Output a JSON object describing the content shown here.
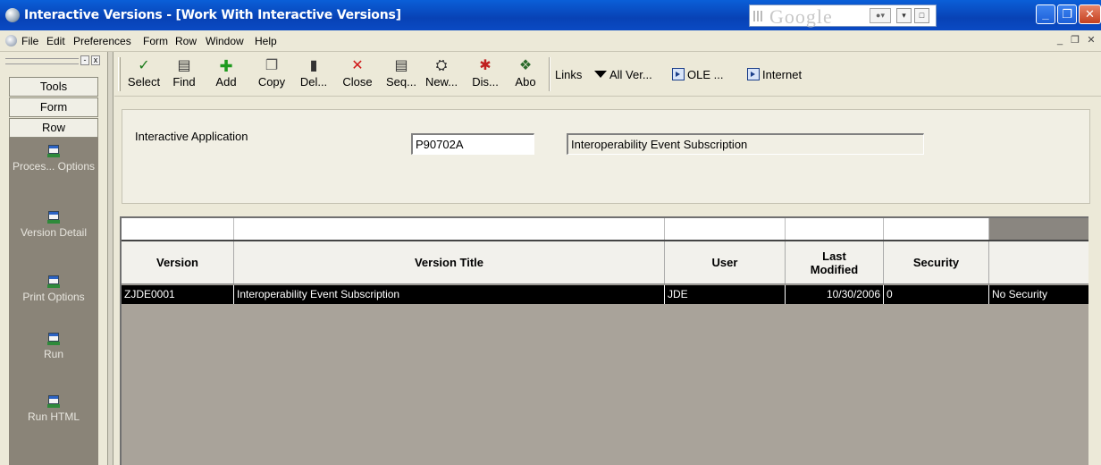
{
  "window": {
    "title": "Interactive Versions - [Work With Interactive Versions]",
    "google_logo": "Google"
  },
  "menu": [
    "File",
    "Edit",
    "Preferences",
    "Form",
    "Row",
    "Window",
    "Help"
  ],
  "left_panel": {
    "tabs": [
      "Tools",
      "Form",
      "Row"
    ],
    "exits": [
      {
        "label": "Proces... Options"
      },
      {
        "label": "Version Detail"
      },
      {
        "label": "Print Options"
      },
      {
        "label": "Run"
      },
      {
        "label": "Run HTML"
      }
    ]
  },
  "toolbar": {
    "buttons": [
      {
        "label": "Select",
        "icon": "check-icon"
      },
      {
        "label": "Find",
        "icon": "find-icon"
      },
      {
        "label": "Add",
        "icon": "add-icon"
      },
      {
        "label": "Copy",
        "icon": "copy-icon"
      },
      {
        "label": "Del...",
        "icon": "delete-icon"
      },
      {
        "label": "Close",
        "icon": "close-icon"
      },
      {
        "label": "Seq...",
        "icon": "sequence-icon"
      },
      {
        "label": "New...",
        "icon": "new-icon"
      },
      {
        "label": "Dis...",
        "icon": "display-icon"
      },
      {
        "label": "Abo",
        "icon": "about-icon"
      }
    ],
    "links_label": "Links",
    "links": [
      "All Ver...",
      "OLE ...",
      "Internet"
    ]
  },
  "header": {
    "field_label": "Interactive Application",
    "app_code": "P90702A",
    "app_description": "Interoperability Event Subscription"
  },
  "grid": {
    "columns": [
      "Version",
      "Version Title",
      "User",
      "Last Modified",
      "Security",
      ""
    ],
    "rows": [
      [
        "ZJDE0001",
        "Interoperability Event Subscription",
        "JDE",
        "10/30/2006",
        "0",
        "No Security"
      ]
    ]
  }
}
